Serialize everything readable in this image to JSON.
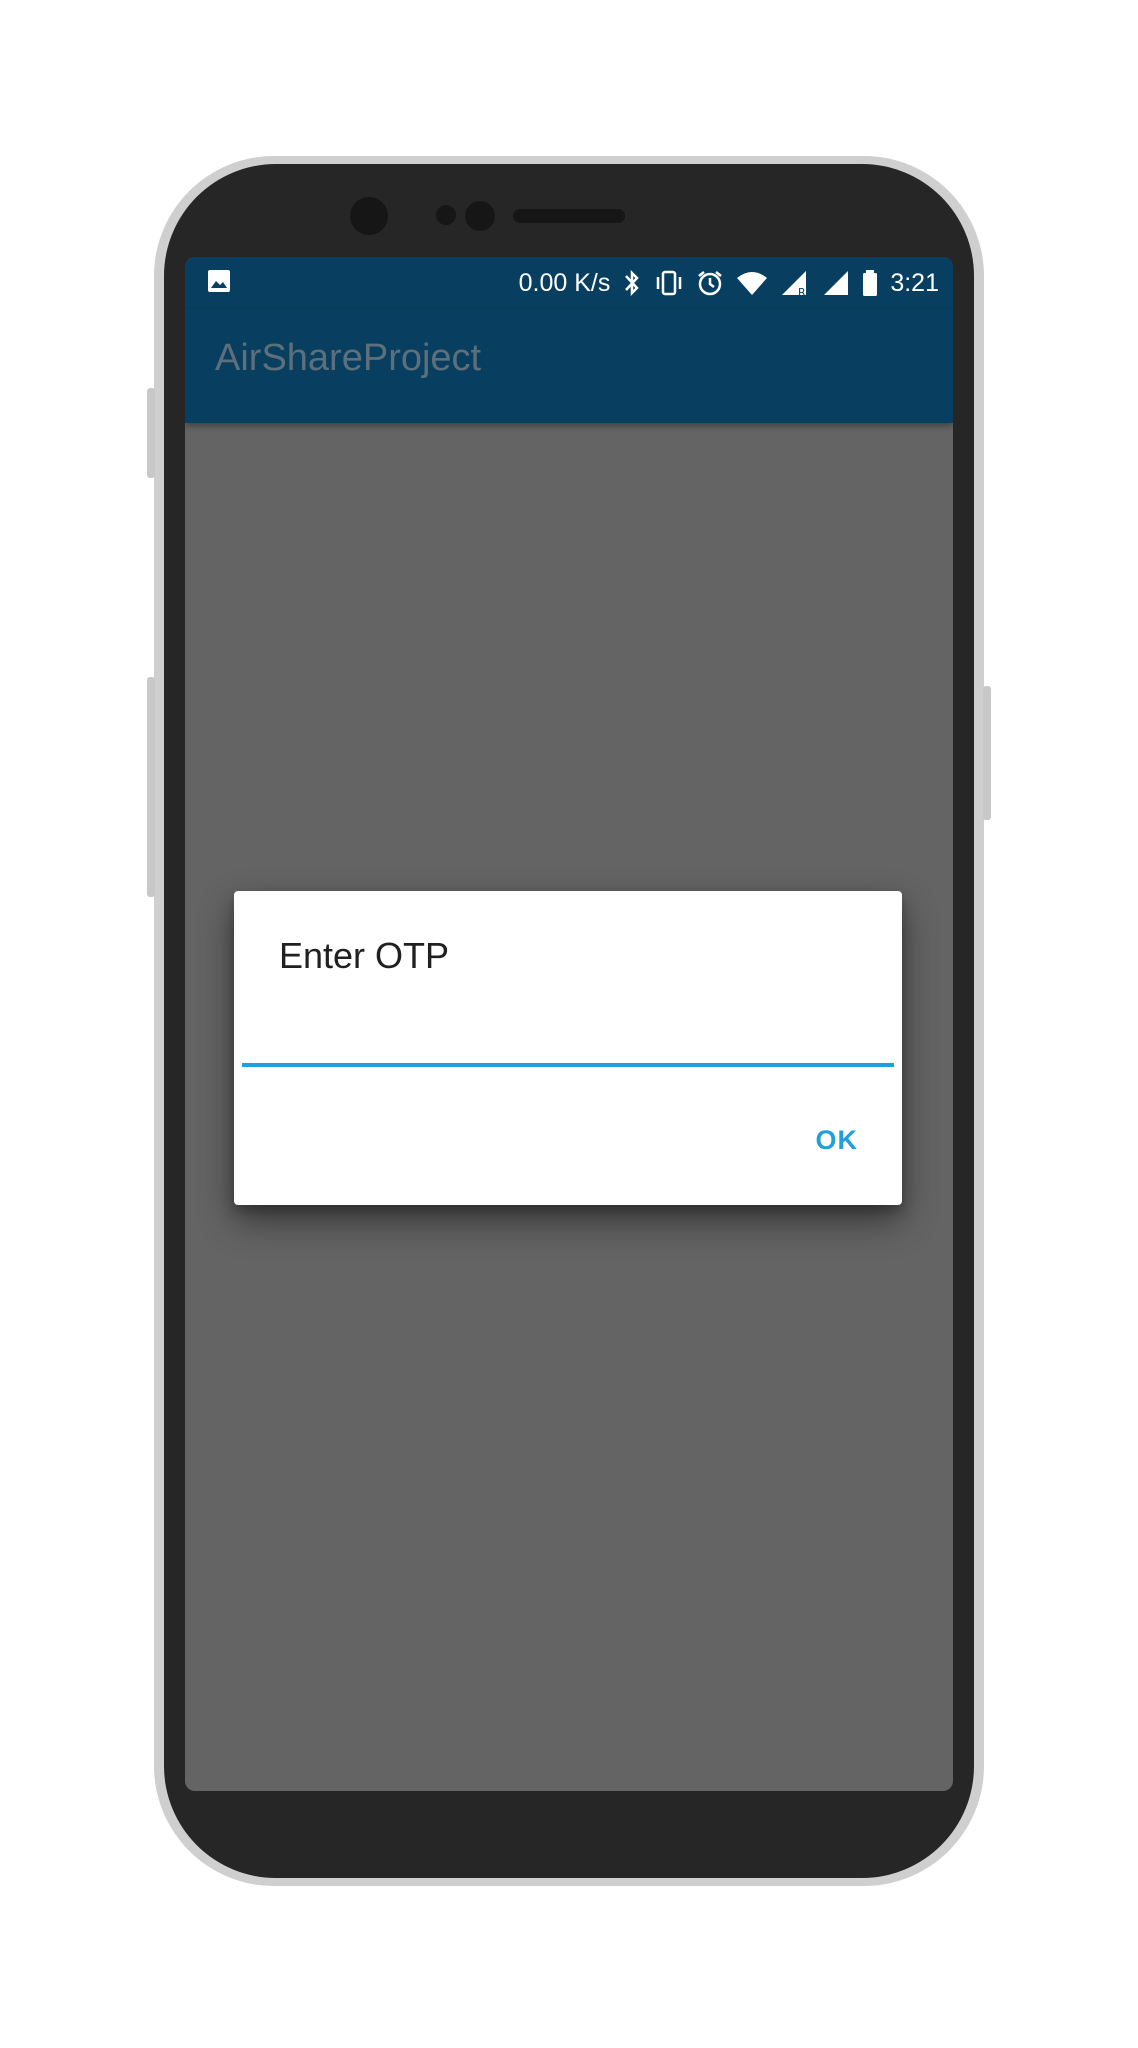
{
  "status_bar": {
    "notification_icon": "image-icon",
    "network_speed": "0.00 K/s",
    "icons": [
      "bluetooth-icon",
      "vibrate-icon",
      "alarm-icon",
      "wifi-icon",
      "signal-roaming-icon",
      "signal-icon",
      "battery-icon"
    ],
    "time": "3:21"
  },
  "app_bar": {
    "title": "AirShareProject"
  },
  "dialog": {
    "title": "Enter OTP",
    "input_value": "",
    "ok_label": "OK"
  },
  "colors": {
    "app_bar": "#083f60",
    "accent": "#1f9fdb",
    "scrim": "#646464",
    "dialog_bg": "#ffffff"
  }
}
